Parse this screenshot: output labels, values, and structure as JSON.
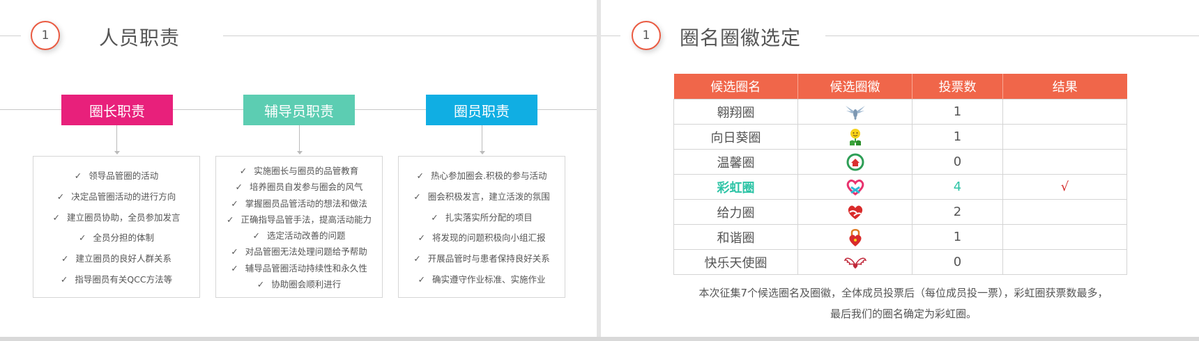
{
  "left": {
    "number": "1",
    "title": "人员职责",
    "roles": [
      {
        "title": "圈长职责",
        "color": "#e8207b",
        "items": [
          "领导品管圈的活动",
          "决定品管圈活动的进行方向",
          "建立圈员协助，全员参加发言",
          "全员分担的体制",
          "建立圈员的良好人群关系",
          "指导圈员有关QCC方法等"
        ]
      },
      {
        "title": "辅导员职责",
        "color": "#5ccdb2",
        "items": [
          "实施圈长与圈员的品管教育",
          "培养圈员自发参与圈会的风气",
          "掌握圈员品管活动的想法和做法",
          "正确指导品管手法，提高活动能力",
          "选定活动改善的问题",
          "对品管圈无法处理问题给予帮助",
          "辅导品管圈活动持续性和永久性",
          "协助圈会顺利进行"
        ]
      },
      {
        "title": "圈员职责",
        "color": "#10aee3",
        "items": [
          "热心参加圈会.积极的参与活动",
          "圈会积极发言，建立活泼的氛围",
          "扎实落实所分配的项目",
          "将发现的问题积极向小组汇报",
          "开展品管时与患者保持良好关系",
          "确实遵守作业标准、实施作业"
        ]
      }
    ],
    "check_mark": "✓"
  },
  "right": {
    "number": "1",
    "title": "圈名圈徽选定",
    "table": {
      "headers": [
        "候选圈名",
        "候选圈徽",
        "投票数",
        "结果"
      ],
      "rows": [
        {
          "name": "翱翔圈",
          "emblem": "eagle-icon",
          "votes": "1",
          "result": ""
        },
        {
          "name": "向日葵圈",
          "emblem": "sunflower-icon",
          "votes": "1",
          "result": ""
        },
        {
          "name": "温馨圈",
          "emblem": "house-icon",
          "votes": "0",
          "result": ""
        },
        {
          "name": "彩虹圈",
          "emblem": "ribbon-heart-icon",
          "votes": "4",
          "result": "√",
          "highlight": true
        },
        {
          "name": "给力圈",
          "emblem": "heart-hands-icon",
          "votes": "2",
          "result": ""
        },
        {
          "name": "和谐圈",
          "emblem": "lock-heart-icon",
          "votes": "1",
          "result": ""
        },
        {
          "name": "快乐天使圈",
          "emblem": "angel-wings-icon",
          "votes": "0",
          "result": ""
        }
      ]
    },
    "summary_line1": "本次征集7个候选圈名及圈徽，全体成员投票后（每位成员投一票），彩虹圈获票数最多，",
    "summary_line2": "最后我们的圈名确定为彩虹圈。"
  },
  "colors": {
    "accent": "#ea5a41",
    "table_header": "#f0664a",
    "highlight": "#2ec4a6",
    "check": "#d42a2a"
  }
}
